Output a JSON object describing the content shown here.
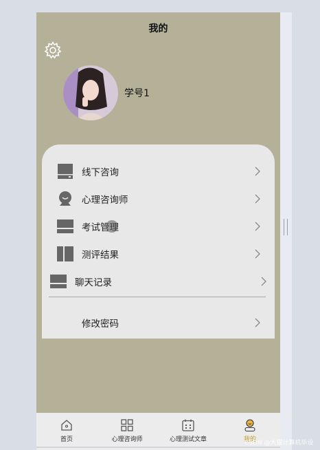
{
  "header": {
    "title": "我的"
  },
  "profile": {
    "username": "学号1",
    "avatar_alt": "avatar"
  },
  "menu": [
    {
      "label": "线下咨询",
      "icon": "drive-icon"
    },
    {
      "label": "心理咨询师",
      "icon": "webcam-icon"
    },
    {
      "label": "考试管理",
      "icon": "monitor-icon"
    },
    {
      "label": "测评结果",
      "icon": "panel-icon"
    },
    {
      "label": "聊天记录",
      "icon": "monitor-icon"
    },
    {
      "label": "修改密码",
      "icon": ""
    }
  ],
  "tabbar": [
    {
      "label": "首页",
      "icon": "home-icon"
    },
    {
      "label": "心理咨询师",
      "icon": "grid-icon"
    },
    {
      "label": "心理测试文章",
      "icon": "calendar-icon"
    },
    {
      "label": "我的",
      "icon": "user-icon",
      "active": true
    }
  ],
  "watermark": "CSDN @大猫计算机毕设",
  "colors": {
    "background": "#b4b198",
    "card": "#e8e8e8",
    "active_tab": "#c79a2a"
  }
}
